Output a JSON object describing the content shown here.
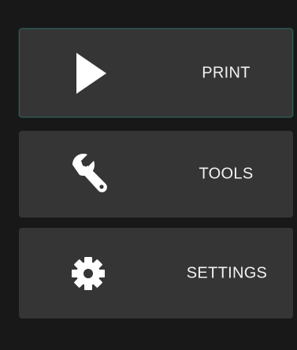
{
  "menu": {
    "items": [
      {
        "id": "print",
        "label": "PRINT",
        "icon": "play-icon",
        "active": true
      },
      {
        "id": "tools",
        "label": "TOOLS",
        "icon": "wrench-icon",
        "active": false
      },
      {
        "id": "settings",
        "label": "SETTINGS",
        "icon": "gear-icon",
        "active": false
      }
    ]
  },
  "colors": {
    "background": "#181818",
    "button": "#353535",
    "text": "#f2f2f2",
    "active_border": "#2f5f58"
  }
}
